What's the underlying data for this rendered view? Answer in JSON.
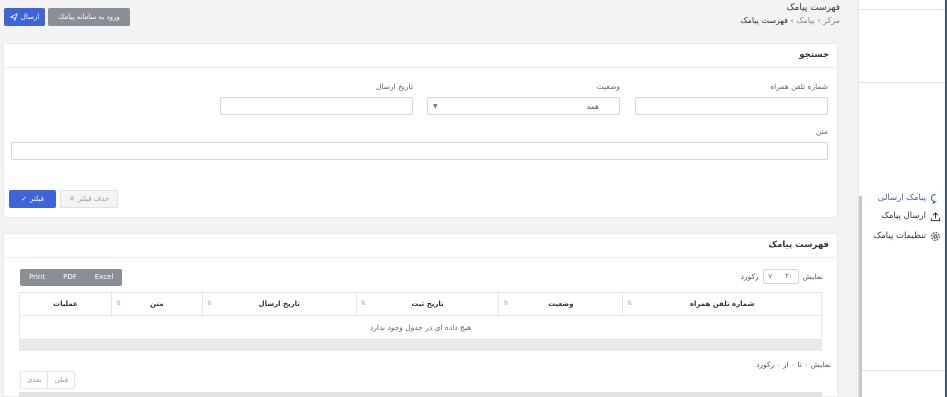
{
  "header": {
    "page_title": "فهرست پیامک",
    "breadcrumb": [
      "مرکز",
      "پیامک",
      "فهرست پیامک"
    ],
    "send_button": "ارسال",
    "panel_button": "ورود به سامانه پیامک"
  },
  "sidebar": {
    "items": [
      {
        "label": "پیامک ارسالی",
        "icon": "chat-bubble-icon",
        "active": true
      },
      {
        "label": "ارسال پیامک",
        "icon": "upload-icon",
        "active": false
      },
      {
        "label": "تنظیمات پیامک",
        "icon": "gear-icon",
        "active": false
      }
    ]
  },
  "search": {
    "title": "جستجو",
    "phone_label": "شماره تلفن همراه",
    "status_label": "وضعیت",
    "status_value": "همه",
    "send_date_label": "تاریخ ارسال",
    "text_label": "متن",
    "filter_button": "فیلتر",
    "clear_button": "حذف فیلتر"
  },
  "list": {
    "title": "فهرست پیامک",
    "export_buttons": [
      "Print",
      "PDF",
      "Excel"
    ],
    "length_prefix": "نمایش",
    "length_value": "۲۰",
    "length_suffix": "رکورد",
    "columns": [
      "شماره تلفن همراه",
      "وضعیت",
      "تاریخ ثبت",
      "تاریخ ارسال",
      "متن",
      "عملیات"
    ],
    "empty_message": "هیچ داده ای در جدول وجود ندارد",
    "info": "نمایش ۰ تا ۰ از ۰ رکورد",
    "prev_button": "قبلی",
    "next_button": "بعدی"
  },
  "colors": {
    "primary": "#3f63d9",
    "secondary": "#8a8f97",
    "sidebar_active": "#3a5bc7"
  }
}
